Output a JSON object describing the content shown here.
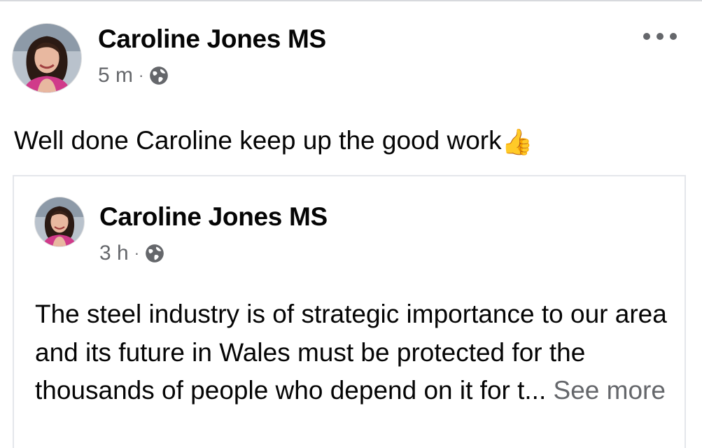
{
  "post": {
    "author": "Caroline Jones MS",
    "time": "5 m",
    "separator": "·",
    "privacy_icon": "globe-icon",
    "more_icon": "more-options-icon",
    "text": "Well done Caroline keep up the good work",
    "emoji": "👍"
  },
  "shared_post": {
    "author": "Caroline Jones MS",
    "time": "3 h",
    "separator": "·",
    "privacy_icon": "globe-icon",
    "text": "The steel industry is of strategic importance to our area and its future in Wales must be protected for the thousands of people who depend on it for t...",
    "see_more": "See more"
  },
  "colors": {
    "primary_text": "#050505",
    "secondary_text": "#65676b",
    "border": "#e4e6eb"
  }
}
